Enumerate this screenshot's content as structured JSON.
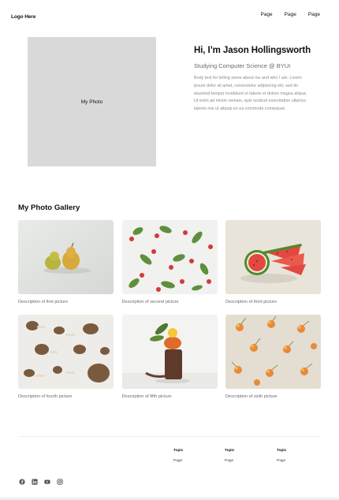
{
  "nav": {
    "logo": "Logo Here",
    "links": [
      "Page",
      "Page",
      "Page"
    ]
  },
  "hero": {
    "photo_label": "My Photo",
    "title": "Hi, I’m Jason Hollingsworth",
    "subtitle": "Studying Computer Science @ BYUI",
    "body": "Body text for telling some about me and who I am. Lorem ipsum dolor sit amet, consectetur adipiscing elit, sed do eiusmod tempor incididunt ut labore et dolore magna aliqua. Ut enim ad minim veniam, quis nostrud exercitation ullamco laboris nisi ut aliquip ex ea commodo consequat."
  },
  "gallery": {
    "title": "My Photo Gallery",
    "items": [
      {
        "description": "Description of first picture",
        "icon": "pears-photo"
      },
      {
        "description": "Description of second picture",
        "icon": "radishes-photo"
      },
      {
        "description": "Description of third picture",
        "icon": "watermelon-photo"
      },
      {
        "description": "Description of fourth picture",
        "icon": "mushrooms-photo"
      },
      {
        "description": "Description of fifth picture",
        "icon": "vegetable-stack-photo"
      },
      {
        "description": "Description of sixth picture",
        "icon": "cherries-photo"
      }
    ]
  },
  "footer": {
    "columns": [
      {
        "topic": "Topic",
        "page": "Page"
      },
      {
        "topic": "Topic",
        "page": "Page"
      },
      {
        "topic": "Topic",
        "page": "Page"
      }
    ],
    "socials": [
      "facebook-icon",
      "linkedin-icon",
      "youtube-icon",
      "instagram-icon"
    ]
  }
}
